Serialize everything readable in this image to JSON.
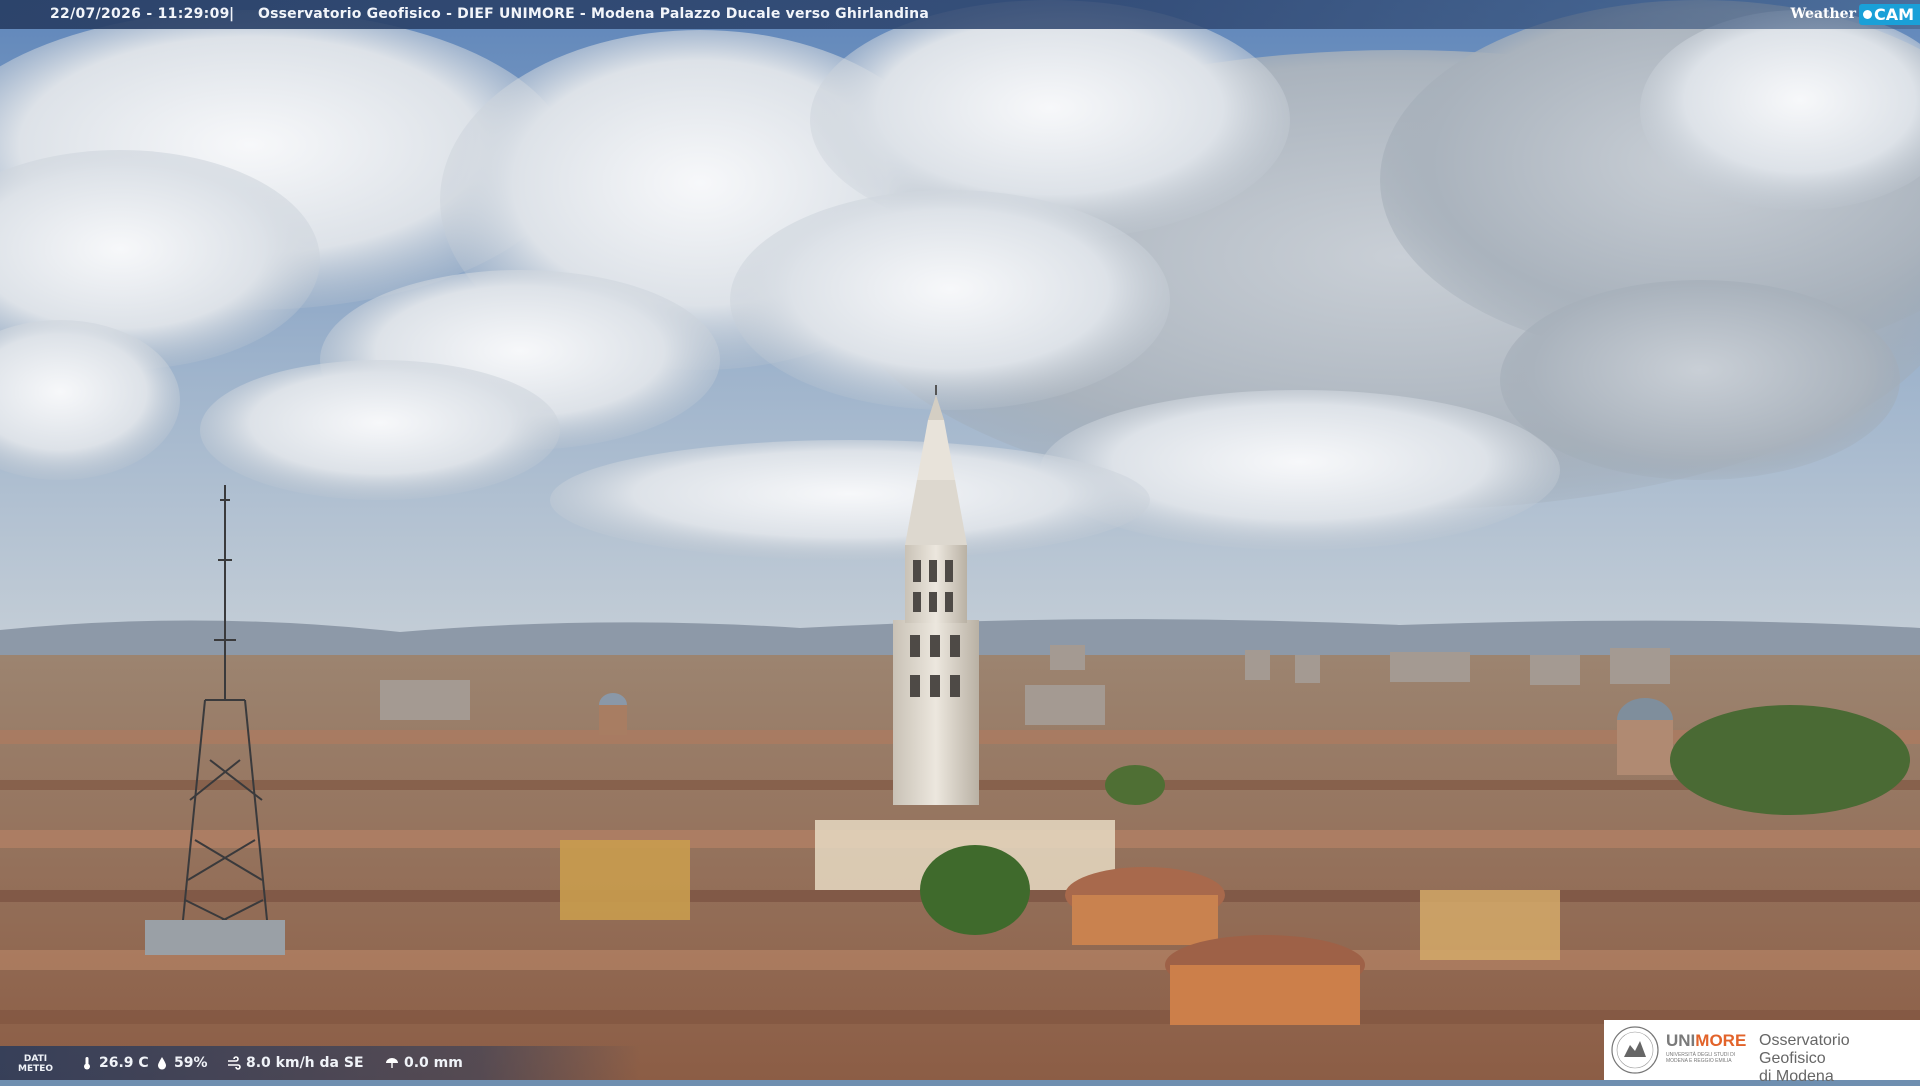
{
  "overlay": {
    "timestamp": "22/07/2026 - 11:29:09",
    "separator": "|",
    "title": "Osservatorio Geofisico - DIEF UNIMORE - Modena Palazzo Ducale verso Ghirlandina",
    "brand_weather": "Weather",
    "brand_cam": "CAM"
  },
  "weather_bar": {
    "label_line1": "DATI",
    "label_line2": "METEO",
    "temperature": "26.9 C",
    "humidity": "59%",
    "wind": "8.0 km/h da SE",
    "rain": "0.0 mm",
    "icons": [
      "thermometer-icon",
      "humidity-drop-icon",
      "wind-icon",
      "rain-icon"
    ]
  },
  "logo": {
    "uni_part1": "UNI",
    "uni_part2": "MORE",
    "uni_subtitle": "UNIVERSITÀ DEGLI STUDI DI MODENA E REGGIO EMILIA",
    "observatory_line1": "Osservatorio Geofisico",
    "observatory_line2": "di Modena"
  },
  "colors": {
    "sky_blue": "#6f95c4",
    "cloud": "#e9ecf0",
    "roof": "#b4785a",
    "tower": "#d9d3c8",
    "overlay_bar": "#2e4670",
    "brand_cam": "#1aa0d8",
    "unimore_orange": "#e2632a"
  }
}
